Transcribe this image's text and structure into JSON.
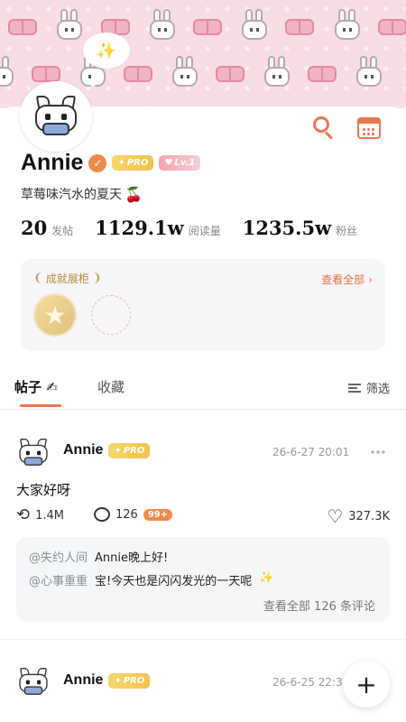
{
  "profile": {
    "name": "Annie",
    "pro_label": "PRO",
    "level_label": "Lv.1",
    "bio": "草莓味汽水的夏天",
    "bio_emoji": "🍒"
  },
  "stats": [
    {
      "value": "20",
      "label": "发帖"
    },
    {
      "value": "1129.1w",
      "label": "阅读量"
    },
    {
      "value": "1235.5w",
      "label": "粉丝"
    }
  ],
  "achievements": {
    "title": "成就展柜",
    "more_label": "查看全部",
    "more_arrow": "›"
  },
  "tabs": {
    "posts": "帖子",
    "posts_emoji": "✍",
    "favorites": "收藏",
    "filter": "筛选"
  },
  "post1": {
    "author": "Annie",
    "pro_label": "PRO",
    "time": "26-6-27 20:01",
    "text": "大家好呀",
    "reposts": "1.4M",
    "comments": "126",
    "hot_badge": "99+",
    "likes": "327.3K",
    "comment_list": [
      {
        "user": "@失约人间",
        "text": "Annie晚上好!"
      },
      {
        "user": "@心事重重",
        "text": "宝!今天也是闪闪发光的一天呢",
        "emoji": "✨"
      }
    ],
    "view_all": "查看全部 126 条评论"
  },
  "post2": {
    "author": "Annie",
    "pro_label": "PRO",
    "time": "26-6-25 22:3"
  },
  "fab_label": "+",
  "icons": {
    "search": "search-icon",
    "calendar": "calendar-icon",
    "verify": "verified-icon",
    "sparkle": "sparkle-icon"
  },
  "colors": {
    "accent": "#e8764f",
    "banner": "#f8dde4",
    "pro_gold": "#f1c24a"
  }
}
